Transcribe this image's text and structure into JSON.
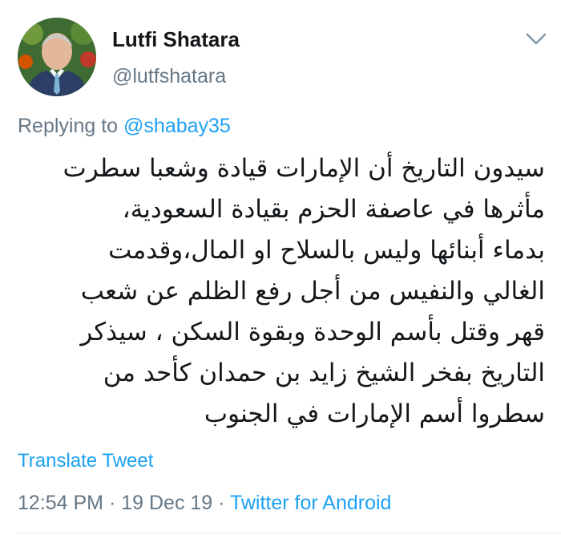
{
  "author": {
    "name": "Lutfi Shatara",
    "handle": "@lutfshatara"
  },
  "reply": {
    "prefix": "Replying to ",
    "mention": "@shabay35"
  },
  "tweet": {
    "lines": [
      "سيدون التاريخ أن الإمارات قيادة وشعبا سطرت",
      "مأثرها في عاصفة الحزم بقيادة السعودية،",
      "بدماء أبنائها وليس بالسلاح او المال،وقدمت",
      "الغالي والنفيس من أجل رفع الظلم عن شعب",
      "قهر وقتل بأسم الوحدة وبقوة السكن ، سيذكر",
      "التاريخ بفخر  الشيخ زايد بن حمدان كأحد من",
      "سطروا أسم الإمارات في الجنوب"
    ]
  },
  "actions": {
    "translate_label": "Translate Tweet"
  },
  "meta": {
    "time": "12:54 PM",
    "separator1": " · ",
    "date": "19 Dec 19",
    "separator2": " · ",
    "source": "Twitter for Android"
  },
  "colors": {
    "link": "#1da1f2",
    "secondary_text": "#657786",
    "primary_text": "#14171a"
  },
  "icons": {
    "more": "chevron-down-icon",
    "avatar": "avatar"
  }
}
